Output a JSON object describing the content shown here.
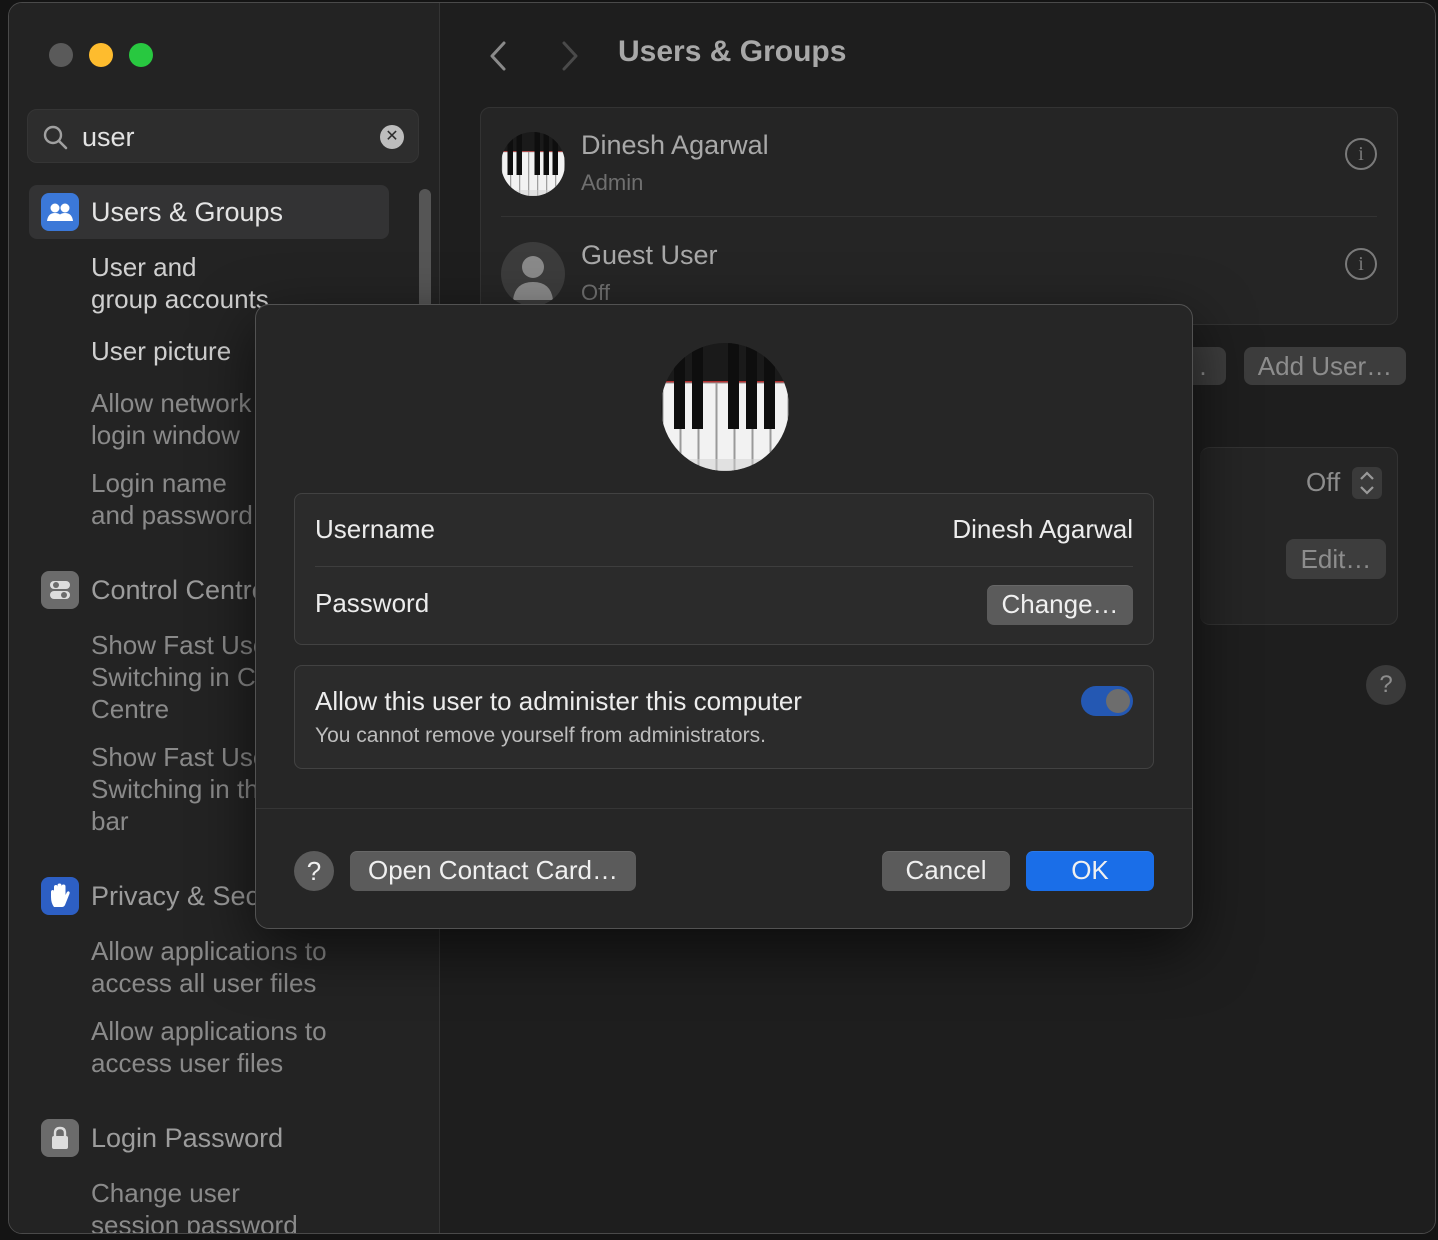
{
  "search": {
    "value": "user"
  },
  "sidebar": {
    "groups": [
      {
        "title": "Users & Groups",
        "items": [
          "User and\ngroup accounts",
          "User picture",
          "Allow network\nlogin window",
          "Login name\nand password"
        ]
      },
      {
        "title": "Control Centre",
        "items": [
          "Show Fast User\nSwitching in Control\nCentre",
          "Show Fast User\nSwitching in the menu\nbar"
        ]
      },
      {
        "title": "Privacy & Security",
        "items": [
          "Allow applications to\naccess all user files",
          "Allow applications to\naccess user files"
        ]
      },
      {
        "title": "Login Password",
        "items": [
          "Change user\nsession password"
        ]
      }
    ]
  },
  "main": {
    "title": "Users & Groups",
    "users": [
      {
        "name": "Dinesh Agarwal",
        "role": "Admin"
      },
      {
        "name": "Guest User",
        "role": "Off"
      }
    ],
    "add_user_label": "Add User…",
    "auto_login_value": "Off",
    "edit_label": "Edit…",
    "help_label": "?"
  },
  "dialog": {
    "username_label": "Username",
    "username_value": "Dinesh Agarwal",
    "password_label": "Password",
    "change_label": "Change…",
    "admin_title": "Allow this user to administer this computer",
    "admin_subtitle": "You cannot remove yourself from administrators.",
    "admin_toggle_on": true,
    "help_label": "?",
    "contact_card_label": "Open Contact Card…",
    "cancel_label": "Cancel",
    "ok_label": "OK"
  },
  "colors": {
    "accent": "#1a6ee8",
    "window_bg": "#1f1f1f",
    "sheet_bg": "#262626"
  }
}
